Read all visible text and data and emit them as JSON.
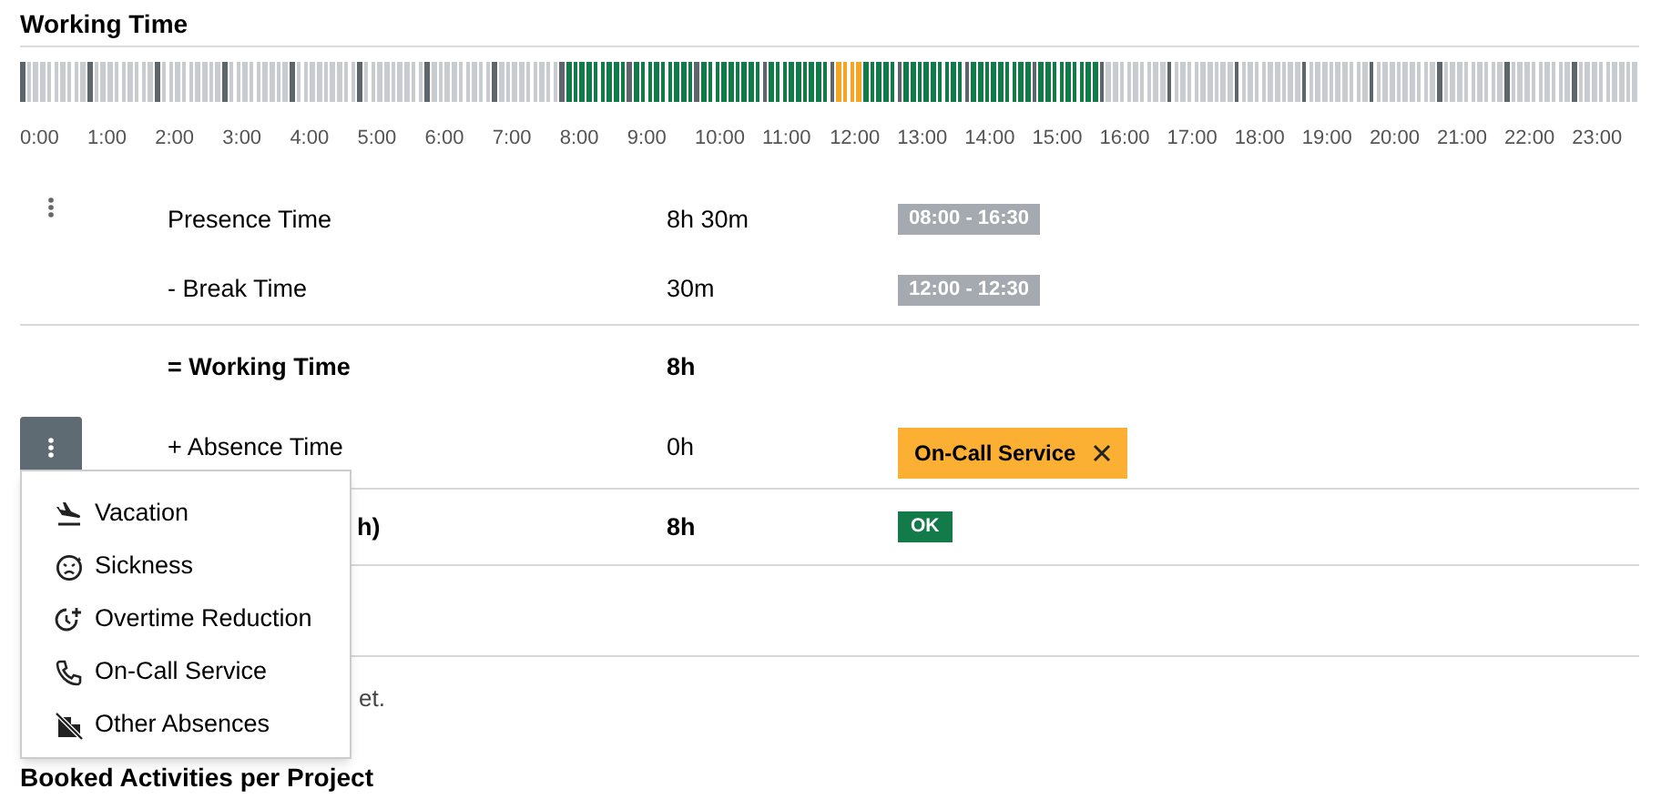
{
  "heading": "Working Time",
  "timeline": {
    "hours": [
      {
        "label": "0:00",
        "kind": "off"
      },
      {
        "label": "1:00",
        "kind": "off"
      },
      {
        "label": "2:00",
        "kind": "off"
      },
      {
        "label": "3:00",
        "kind": "off"
      },
      {
        "label": "4:00",
        "kind": "off"
      },
      {
        "label": "5:00",
        "kind": "off"
      },
      {
        "label": "6:00",
        "kind": "off"
      },
      {
        "label": "7:00",
        "kind": "off"
      },
      {
        "label": "8:00",
        "kind": "work"
      },
      {
        "label": "9:00",
        "kind": "work"
      },
      {
        "label": "10:00",
        "kind": "work"
      },
      {
        "label": "11:00",
        "kind": "work"
      },
      {
        "label": "12:00",
        "kind": "break_then_work"
      },
      {
        "label": "13:00",
        "kind": "work"
      },
      {
        "label": "14:00",
        "kind": "work"
      },
      {
        "label": "15:00",
        "kind": "work"
      },
      {
        "label": "16:00",
        "kind": "off"
      },
      {
        "label": "17:00",
        "kind": "off"
      },
      {
        "label": "18:00",
        "kind": "off"
      },
      {
        "label": "19:00",
        "kind": "off"
      },
      {
        "label": "20:00",
        "kind": "off"
      },
      {
        "label": "21:00",
        "kind": "off"
      },
      {
        "label": "22:00",
        "kind": "off"
      },
      {
        "label": "23:00",
        "kind": "off"
      }
    ]
  },
  "rows": [
    {
      "label": "Presence Time",
      "value": "8h 30m",
      "bold": false,
      "has_menu": true,
      "menu_open": false,
      "badge": {
        "kind": "range",
        "text": "08:00 - 16:30"
      },
      "rule_after": false
    },
    {
      "label": "- Break Time",
      "value": "30m",
      "bold": false,
      "has_menu": false,
      "badge": {
        "kind": "range",
        "text": "12:00 - 12:30"
      },
      "rule_after": true
    },
    {
      "label": "= Working Time",
      "value": "8h",
      "bold": true,
      "has_menu": false,
      "rule_after": false
    },
    {
      "label": "+ Absence Time",
      "value": "0h",
      "bold": false,
      "has_menu": true,
      "menu_open": true,
      "badge": {
        "kind": "tag",
        "text": "On-Call Service"
      },
      "rule_after": true
    },
    {
      "label": "h)",
      "value": "8h",
      "bold": true,
      "has_menu": false,
      "badge": {
        "kind": "ok",
        "text": "OK"
      },
      "rule_after": true
    }
  ],
  "menu_items": [
    {
      "label": "Vacation"
    },
    {
      "label": "Sickness"
    },
    {
      "label": "Overtime Reduction"
    },
    {
      "label": "On-Call Service"
    },
    {
      "label": "Other Absences"
    }
  ],
  "note": "et.",
  "heading2": "Booked Activities per Project"
}
